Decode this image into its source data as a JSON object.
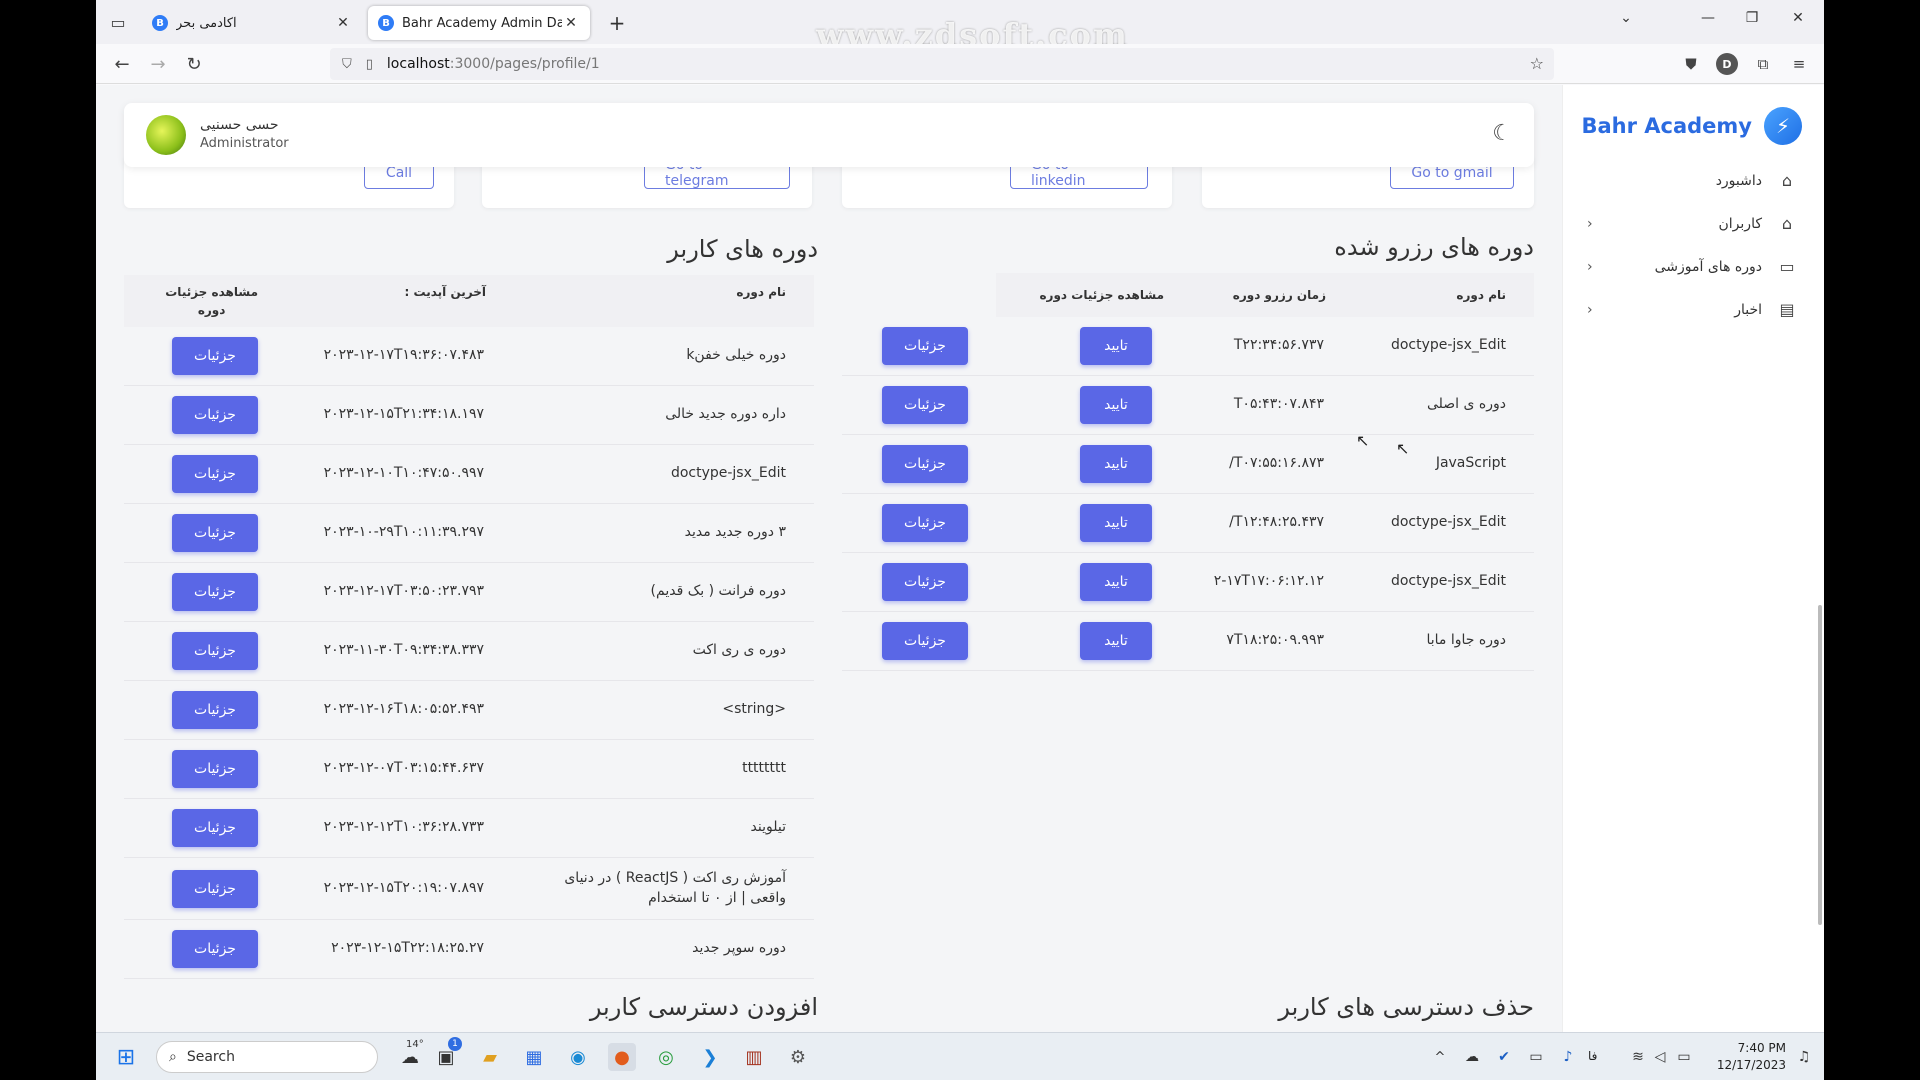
{
  "browser": {
    "tabs": [
      {
        "title": "آکادمی بحر",
        "favicon": "B"
      },
      {
        "title": "Bahr Academy Admin Dashboard",
        "favicon": "B"
      }
    ],
    "watermark": "www.zdsoft.com",
    "url_host": "localhost",
    "url_path": ":3000/pages/profile/1"
  },
  "sidebar": {
    "brand": "Bahr Academy",
    "items": [
      {
        "label": "داشبورد",
        "icon": "home-icon"
      },
      {
        "label": "کاربران",
        "icon": "home-icon"
      },
      {
        "label": "دوره های آموزشی",
        "icon": "monitor-icon"
      },
      {
        "label": "اخبار",
        "icon": "document-icon"
      }
    ]
  },
  "header": {
    "user_name": "حسی حسنیی",
    "user_role": "Administrator"
  },
  "social": {
    "call": "Call",
    "telegram": "Go to telegram",
    "linkedin": "Go to linkedin",
    "gmail": "Go to gmail"
  },
  "reserved": {
    "title": "دوره های رزرو شده",
    "headers": {
      "name": "نام دوره",
      "time": "زمان رزرو دوره",
      "details": "مشاهده جزئیات دوره"
    },
    "approve_label": "تایید",
    "details_label": "جزئیات",
    "rows": [
      {
        "name": "doctype-jsx_Edit",
        "time": "T۲۲:۳۴:۵۶.۷۳۷"
      },
      {
        "name": "دوره ی اصلی",
        "time": "T۰۵:۴۳:۰۷.۸۴۳"
      },
      {
        "name": "JavaScript",
        "time": "/T۰۷:۵۵:۱۶.۸۷۳"
      },
      {
        "name": "doctype-jsx_Edit",
        "time": "/T۱۲:۴۸:۲۵.۴۳۷"
      },
      {
        "name": "doctype-jsx_Edit",
        "time": "۲-۱۷T۱۷:۰۶:۱۲.۱۲"
      },
      {
        "name": "دوره جاوا مابا",
        "time": "۷T۱۸:۲۵:۰۹.۹۹۳"
      }
    ]
  },
  "user_courses": {
    "title": "دوره های کاربر",
    "headers": {
      "name": "نام دوره",
      "updated": "آخرین آپدیت :",
      "details_line1": "مشاهده جزئیات",
      "details_line2": "دوره"
    },
    "details_label": "جزئیات",
    "rows": [
      {
        "name": "دوره خیلی خفنk",
        "updated": "۲۰۲۳-۱۲-۱۷T۱۹:۳۶:۰۷.۴۸۳"
      },
      {
        "name": "داره دوره جدید خالی",
        "updated": "۲۰۲۳-۱۲-۱۵T۲۱:۳۴:۱۸.۱۹۷"
      },
      {
        "name": "doctype-jsx_Edit",
        "updated": "۲۰۲۳-۱۲-۱۰T۱۰:۴۷:۵۰.۹۹۷"
      },
      {
        "name": "۳ دوره جدید مدید",
        "updated": "۲۰۲۳-۱۰-۲۹T۱۰:۱۱:۳۹.۲۹۷"
      },
      {
        "name": "دوره فرانت ( بک قدیم)",
        "updated": "۲۰۲۳-۱۲-۱۷T۰۳:۵۰:۲۳.۷۹۳"
      },
      {
        "name": "دوره ی ری اکت",
        "updated": "۲۰۲۳-۱۱-۳۰T۰۹:۳۴:۳۸.۳۳۷"
      },
      {
        "name": "<string>",
        "updated": "۲۰۲۳-۱۲-۱۶T۱۸:۰۵:۵۲.۴۹۳"
      },
      {
        "name": "tttttttt",
        "updated": "۲۰۲۳-۱۲-۰۷T۰۳:۱۵:۴۴.۶۳۷"
      },
      {
        "name": "تیلویند",
        "updated": "۲۰۲۳-۱۲-۱۲T۱۰:۳۶:۲۸.۷۳۳"
      },
      {
        "name": "آموزش ری اکت ( ReactJS ) در دنیای واقعی | از ۰ تا استخدام",
        "updated": "۲۰۲۳-۱۲-۱۵T۲۰:۱۹:۰۷.۸۹۷"
      },
      {
        "name": "دوره سوپر جدید",
        "updated": "۲۰۲۳-۱۲-۱۵T۲۲:۱۸:۲۵.۲۷"
      }
    ]
  },
  "sections": {
    "remove_access": "حذف دسترسی های کاربر",
    "add_access": "افزودن دسترسی کاربر"
  },
  "taskbar": {
    "search_placeholder": "Search",
    "temperature": "14°",
    "chat_badge": "1",
    "lang": "فا",
    "time": "7:40 PM",
    "date": "12/17/2023"
  },
  "colors": {
    "primary_button": "#5a67e6",
    "brand": "#2b6be0"
  }
}
